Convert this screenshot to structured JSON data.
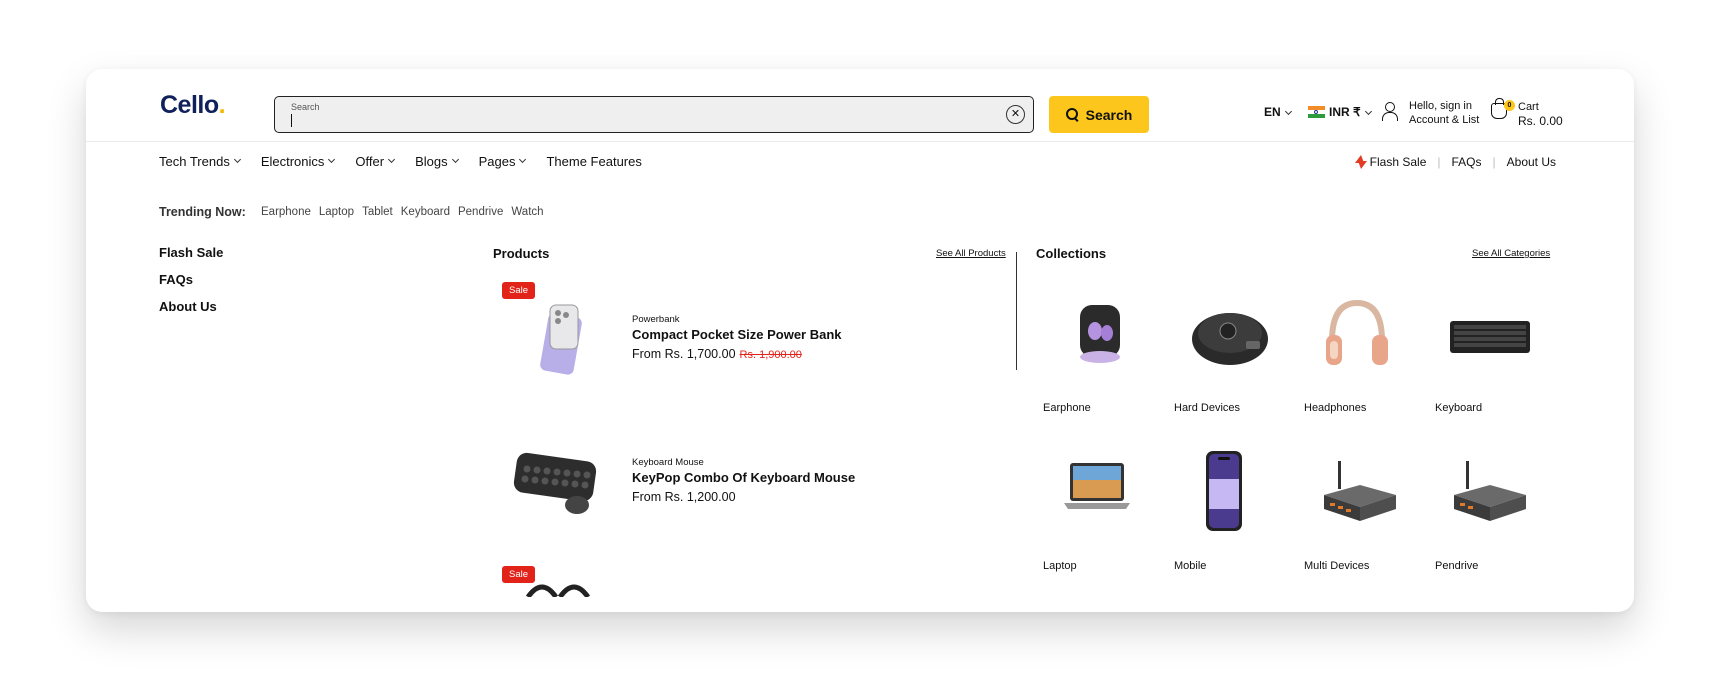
{
  "header": {
    "logo_text": "Cello",
    "logo_dot": ".",
    "search_placeholder": "Search",
    "search_button": "Search",
    "language": "EN",
    "currency": "INR ₹",
    "account_line1": "Hello, sign in",
    "account_line2": "Account & List",
    "cart_count": "0",
    "cart_label": "Cart",
    "cart_total": "Rs. 0.00"
  },
  "nav": {
    "items": [
      "Tech Trends",
      "Electronics",
      "Offer",
      "Blogs",
      "Pages",
      "Theme Features"
    ],
    "right": [
      "Flash Sale",
      "FAQs",
      "About Us"
    ]
  },
  "trending": {
    "label": "Trending Now:",
    "items": [
      "Earphone",
      "Laptop",
      "Tablet",
      "Keyboard",
      "Pendrive",
      "Watch"
    ]
  },
  "left_links": [
    "Flash Sale",
    "FAQs",
    "About Us"
  ],
  "products": {
    "title": "Products",
    "see_all": "See All Products",
    "items": [
      {
        "badge": "Sale",
        "category": "Powerbank",
        "name": "Compact Pocket Size Power Bank",
        "price": "From Rs. 1,700.00",
        "old_price": "Rs. 1,900.00"
      },
      {
        "badge": "",
        "category": "Keyboard Mouse",
        "name": "KeyPop Combo Of Keyboard Mouse",
        "price": "From Rs. 1,200.00",
        "old_price": ""
      },
      {
        "badge": "Sale"
      }
    ]
  },
  "collections": {
    "title": "Collections",
    "see_all": "See All Categories",
    "items": [
      "Earphone",
      "Hard Devices",
      "Headphones",
      "Keyboard",
      "Laptop",
      "Mobile",
      "Multi Devices",
      "Pendrive"
    ]
  },
  "colors": {
    "brand": "#10205a",
    "accent": "#fcc61c",
    "sale": "#e2231a"
  }
}
